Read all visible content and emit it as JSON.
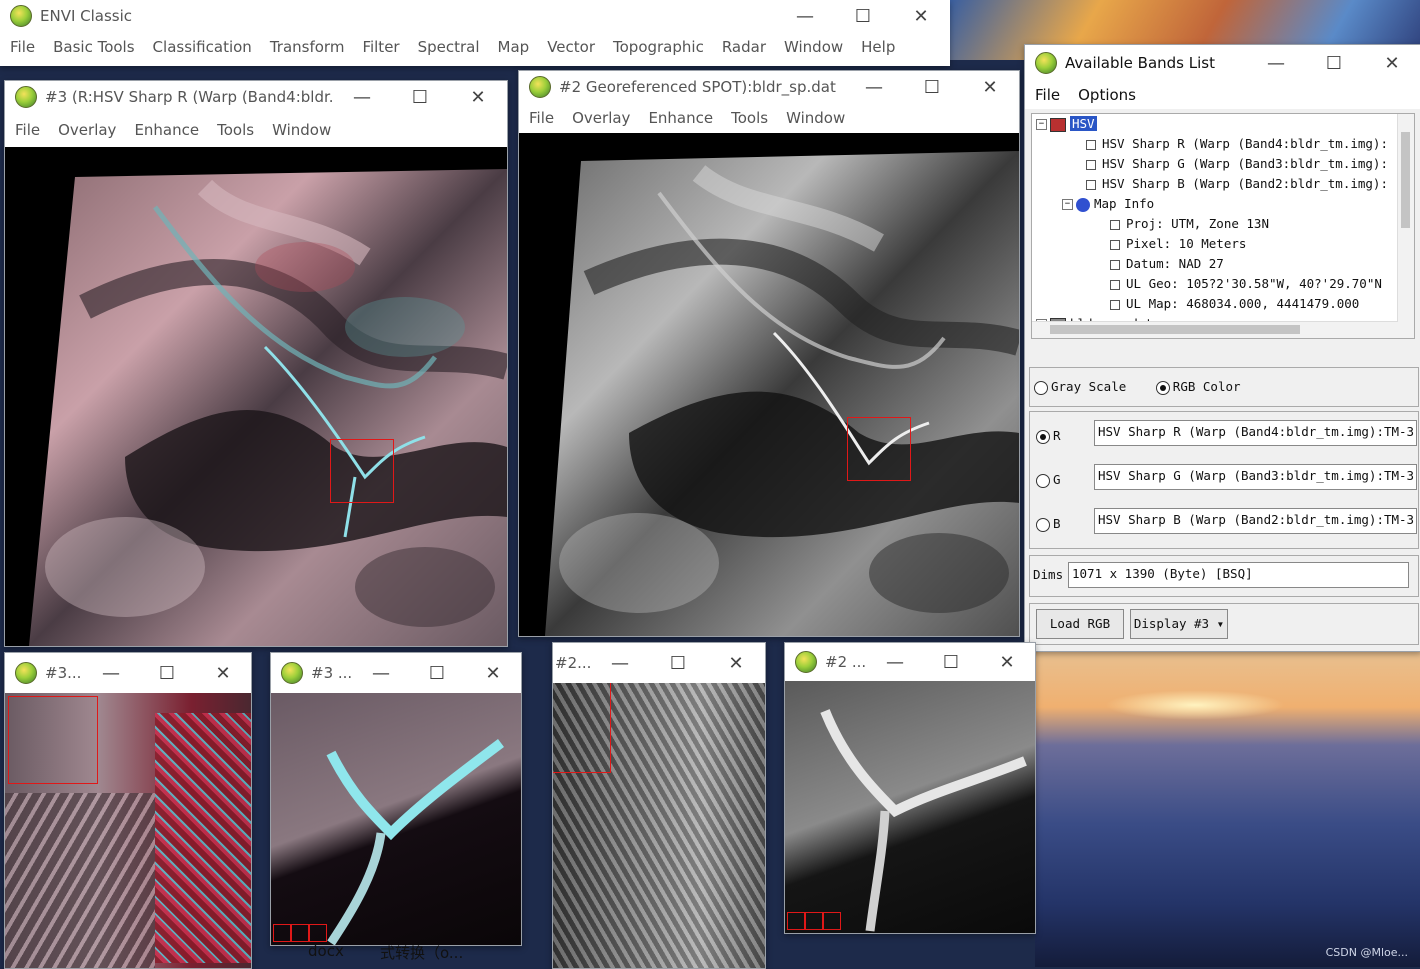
{
  "envi_main": {
    "title": "ENVI Classic",
    "menu": [
      "File",
      "Basic Tools",
      "Classification",
      "Transform",
      "Filter",
      "Spectral",
      "Map",
      "Vector",
      "Topographic",
      "Radar",
      "Window",
      "Help"
    ]
  },
  "display3": {
    "title": "#3 (R:HSV Sharp R (Warp (Band4:bldr...",
    "menu": [
      "File",
      "Overlay",
      "Enhance",
      "Tools",
      "Window"
    ]
  },
  "display2": {
    "title": "#2 Georeferenced SPOT):bldr_sp.dat",
    "menu": [
      "File",
      "Overlay",
      "Enhance",
      "Tools",
      "Window"
    ]
  },
  "small_windows": {
    "scroll3_title": "#3...",
    "zoom3_title": "#3 ...",
    "scroll2_title": "#2...",
    "zoom2_title": "#2 ..."
  },
  "bands_list": {
    "title": "Available Bands List",
    "menu": [
      "File",
      "Options"
    ],
    "tree": {
      "root": "HSV",
      "bands": [
        "HSV Sharp R (Warp (Band4:bldr_tm.img):",
        "HSV Sharp G (Warp (Band3:bldr_tm.img):",
        "HSV Sharp B (Warp (Band2:bldr_tm.img):"
      ],
      "map_info": "Map Info",
      "map_items": [
        "Proj: UTM, Zone 13N",
        "Pixel: 10 Meters",
        "Datum: NAD 27",
        "UL Geo: 105?2'30.58\"W, 40?'29.70\"N",
        "UL Map: 468034.000, 4441479.000"
      ],
      "second_file": "bldr_sp.dat"
    },
    "mode": {
      "gray": "Gray Scale",
      "rgb": "RGB Color",
      "selected": "RGB Color"
    },
    "channels": [
      {
        "label": "R",
        "value": "HSV Sharp R (Warp (Band4:bldr_tm.img):TM-3",
        "selected": true
      },
      {
        "label": "G",
        "value": "HSV Sharp G (Warp (Band3:bldr_tm.img):TM-3",
        "selected": false
      },
      {
        "label": "B",
        "value": "HSV Sharp B (Warp (Band2:bldr_tm.img):TM-3",
        "selected": false
      }
    ],
    "dims_label": "Dims",
    "dims_value": "1071 x 1390 (Byte) [BSQ]",
    "load_button": "Load RGB",
    "display_button": "Display #3"
  },
  "taskbar": {
    "item1": "docx",
    "item2": "式转换（o..."
  },
  "watermark": "CSDN @Mloe..."
}
